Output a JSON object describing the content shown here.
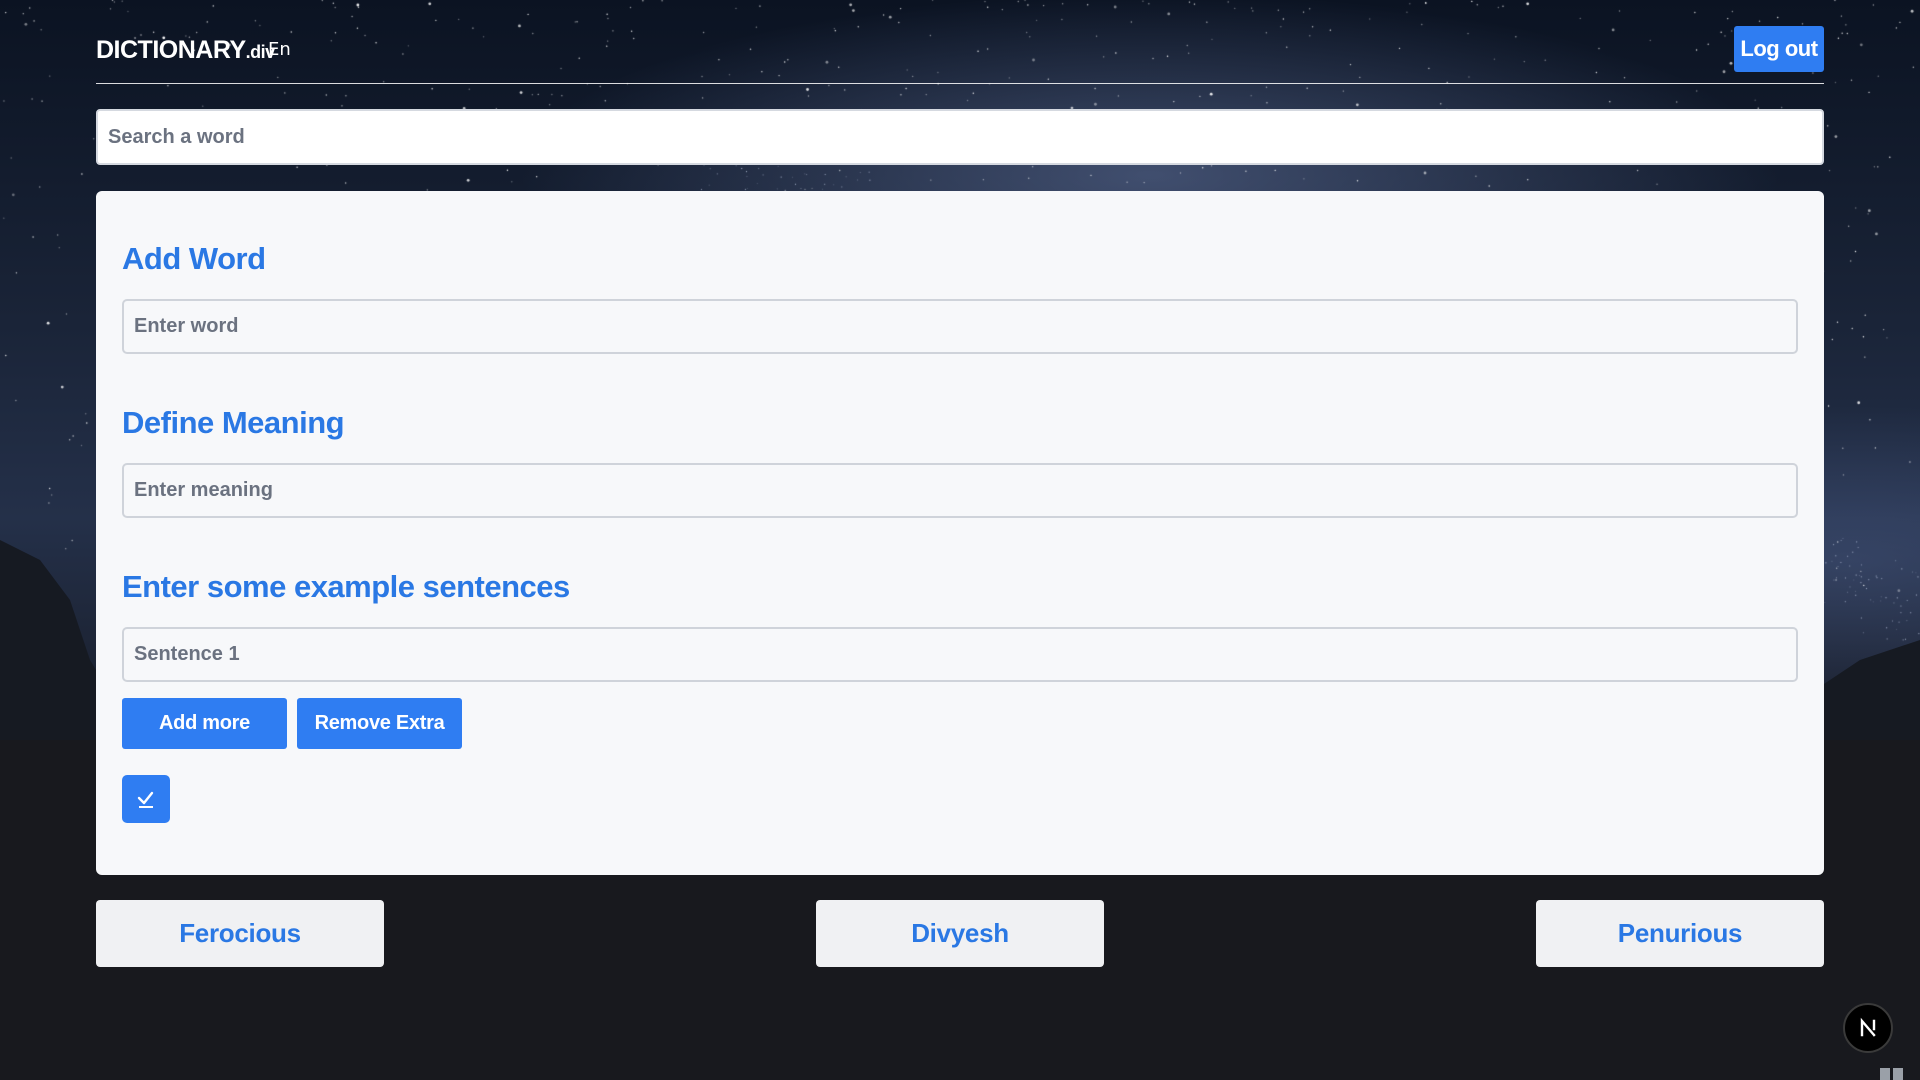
{
  "header": {
    "logo_main": "DICTIONARY",
    "logo_suffix": ".div",
    "language": "En",
    "logout_label": "Log out"
  },
  "search": {
    "placeholder": "Search a word"
  },
  "form": {
    "add_word_title": "Add Word",
    "word_placeholder": "Enter word",
    "define_meaning_title": "Define Meaning",
    "meaning_placeholder": "Enter meaning",
    "examples_title": "Enter some example sentences",
    "sentence_placeholder": "Sentence 1",
    "add_more_label": "Add more",
    "remove_extra_label": "Remove Extra",
    "submit_icon": "check-icon"
  },
  "words": [
    "Ferocious",
    "Divyesh",
    "Penurious"
  ],
  "badge": {
    "letter": "N",
    "icon": "nextjs-logo-icon"
  },
  "colors": {
    "accent": "#2f7df2",
    "heading": "#2a78e4",
    "card_bg": "#f7f8fa",
    "word_card_bg": "#f0f1f3"
  }
}
